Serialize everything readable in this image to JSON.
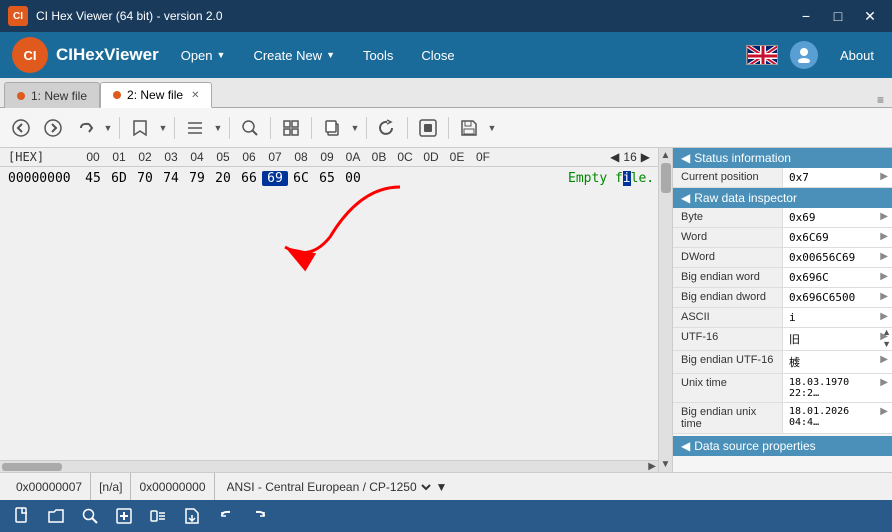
{
  "app": {
    "title": "CI Hex Viewer (64 bit) - version 2.0",
    "logo": "CI",
    "logo_text": "CIHexViewer"
  },
  "titlebar": {
    "title": "CI Hex Viewer (64 bit) - version 2.0",
    "minimize": "−",
    "maximize": "□",
    "close": "✕"
  },
  "menu": {
    "open": "Open",
    "create_new": "Create New",
    "tools": "Tools",
    "close": "Close",
    "about": "About"
  },
  "tabs": [
    {
      "id": 1,
      "label": "1: New file",
      "active": false,
      "closable": false
    },
    {
      "id": 2,
      "label": "2: New file",
      "active": true,
      "closable": true
    }
  ],
  "toolbar": {
    "back": "◀",
    "forward": "▶",
    "redo": "↻",
    "bookmark": "🔖",
    "list": "☰",
    "search": "🔍",
    "grid": "⊞",
    "copy": "⧉",
    "refresh": "↺",
    "toggle1": "▣",
    "save": "💾"
  },
  "hex": {
    "header_label": "[HEX]",
    "columns": [
      "00",
      "01",
      "02",
      "03",
      "04",
      "05",
      "06",
      "07",
      "08",
      "09",
      "0A",
      "0B",
      "0C",
      "0D",
      "0E",
      "0F"
    ],
    "page_size": 16,
    "nav_value": "16",
    "rows": [
      {
        "address": "00000000",
        "bytes": [
          "45",
          "6D",
          "70",
          "74",
          "79",
          "20",
          "66",
          "69",
          "6C",
          "65",
          "00",
          "",
          "",
          "",
          "",
          ""
        ],
        "ascii": "Empty file.",
        "selected_byte_index": 7
      }
    ]
  },
  "status_info": {
    "header": "Status information",
    "current_position_label": "Current position",
    "current_position_value": "0x7"
  },
  "raw_data": {
    "header": "Raw data inspector",
    "rows": [
      {
        "key": "Byte",
        "value": "0x69"
      },
      {
        "key": "Word",
        "value": "0x6C69"
      },
      {
        "key": "DWord",
        "value": "0x00656C69"
      },
      {
        "key": "Big endian word",
        "value": "0x696C"
      },
      {
        "key": "Big endian dword",
        "value": "0x696C6500"
      },
      {
        "key": "ASCII",
        "value": "i"
      },
      {
        "key": "UTF-16",
        "value": "旧"
      },
      {
        "key": "Big endian UTF-16",
        "value": "榩"
      },
      {
        "key": "Unix time",
        "value": "18.03.1970 22:2…"
      },
      {
        "key": "Big endian unix time",
        "value": "18.01.2026 04:4…"
      }
    ]
  },
  "statusbar": {
    "position": "0x00000007",
    "na": "[n/a]",
    "offset": "0x00000000",
    "encoding": "ANSI - Central European / CP-1250"
  },
  "bottom_toolbar": {
    "icons": [
      "new-file",
      "open-file",
      "search",
      "add",
      "navigate",
      "export",
      "undo",
      "redo"
    ]
  }
}
